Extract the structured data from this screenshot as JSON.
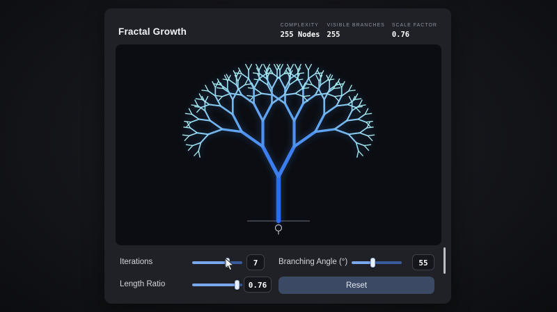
{
  "app": {
    "title": "Fractal Growth"
  },
  "stats": [
    {
      "label": "COMPLEXITY",
      "value": "255 Nodes"
    },
    {
      "label": "VISIBLE BRANCHES",
      "value": "255"
    },
    {
      "label": "SCALE FACTOR",
      "value": "0.76"
    }
  ],
  "controls": {
    "iterations": {
      "label": "Iterations",
      "value": "7",
      "percent": 71
    },
    "branching_angle": {
      "label": "Branching Angle (°)",
      "value": "55",
      "percent": 43
    },
    "length_ratio": {
      "label": "Length Ratio",
      "value": "0.76",
      "percent": 90
    },
    "reset_label": "Reset"
  },
  "fractal": {
    "iterations": 7,
    "branching_angle_deg": 55,
    "length_ratio": 0.76,
    "trunk_color": "#2a6cf0",
    "tip_color": "#a9ecef",
    "ground_color": "#4a4f58"
  },
  "icons": {
    "ground_marker": "tree-icon",
    "pointer": "mouse-cursor"
  }
}
